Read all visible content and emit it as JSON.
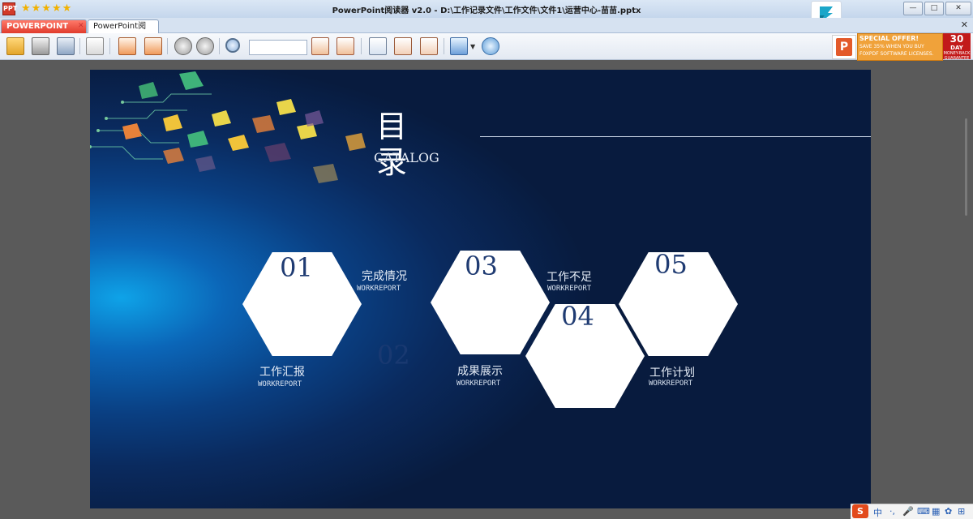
{
  "window": {
    "title": "PowerPoint阅读器 v2.0 - D:\\工作记录文件\\工作文件\\文件1\\运营中心-苗苗.pptx",
    "app_icon_label": "PPT",
    "rating_stars": "★★★★★",
    "minimize": "—",
    "maximize": "□",
    "close": "✕"
  },
  "tabs": [
    {
      "label": "POWERPOINT"
    },
    {
      "label": "PowerPoint阅读器"
    }
  ],
  "tab_close": "✕",
  "tabbar_close": "✕",
  "toolbar": {
    "search_value": "",
    "icons": [
      "open-icon",
      "print-icon",
      "fullscreen-icon",
      "slides-icon",
      "prev-slide-icon",
      "next-slide-icon",
      "page-up-icon",
      "page-down-icon",
      "search-icon",
      "find-prev-icon",
      "find-next-icon",
      "view-normal-icon",
      "view-slide-icon",
      "view-notes-icon",
      "tools-icon",
      "dropdown-icon",
      "help-icon"
    ]
  },
  "promo": {
    "logo": "P",
    "line1": "SPECIAL OFFER!",
    "line2": "SAVE 35% WHEN YOU BUY",
    "line3": "FOXPDF SOFTWARE LICENSES.",
    "days_number": "30",
    "days_label": "DAY",
    "guarantee": "MONEY-BACK GUARANTEE"
  },
  "slide": {
    "title": "目录",
    "subtitle": "CATALOG",
    "ghost_number": "02",
    "items": [
      {
        "number": "01",
        "cn": "工作汇报",
        "en": "WORKREPORT"
      },
      {
        "number": "02",
        "cn": "完成情况",
        "en": "WORKREPORT"
      },
      {
        "number": "03",
        "cn": "成果展示",
        "en": "WORKREPORT"
      },
      {
        "number": "04",
        "cn": "工作不足",
        "en": "WORKREPORT"
      },
      {
        "number": "05",
        "cn": "工作计划",
        "en": "WORKREPORT"
      }
    ],
    "colors": {
      "accent": "#0ea3e8",
      "background_dark": "#081b3e",
      "hex_text": "#1f3b72"
    }
  },
  "tray": {
    "ime_logo": "S",
    "lang": "中",
    "items": [
      "·,",
      "🎤",
      "⌨",
      "▦",
      "✿",
      "⊞"
    ]
  }
}
